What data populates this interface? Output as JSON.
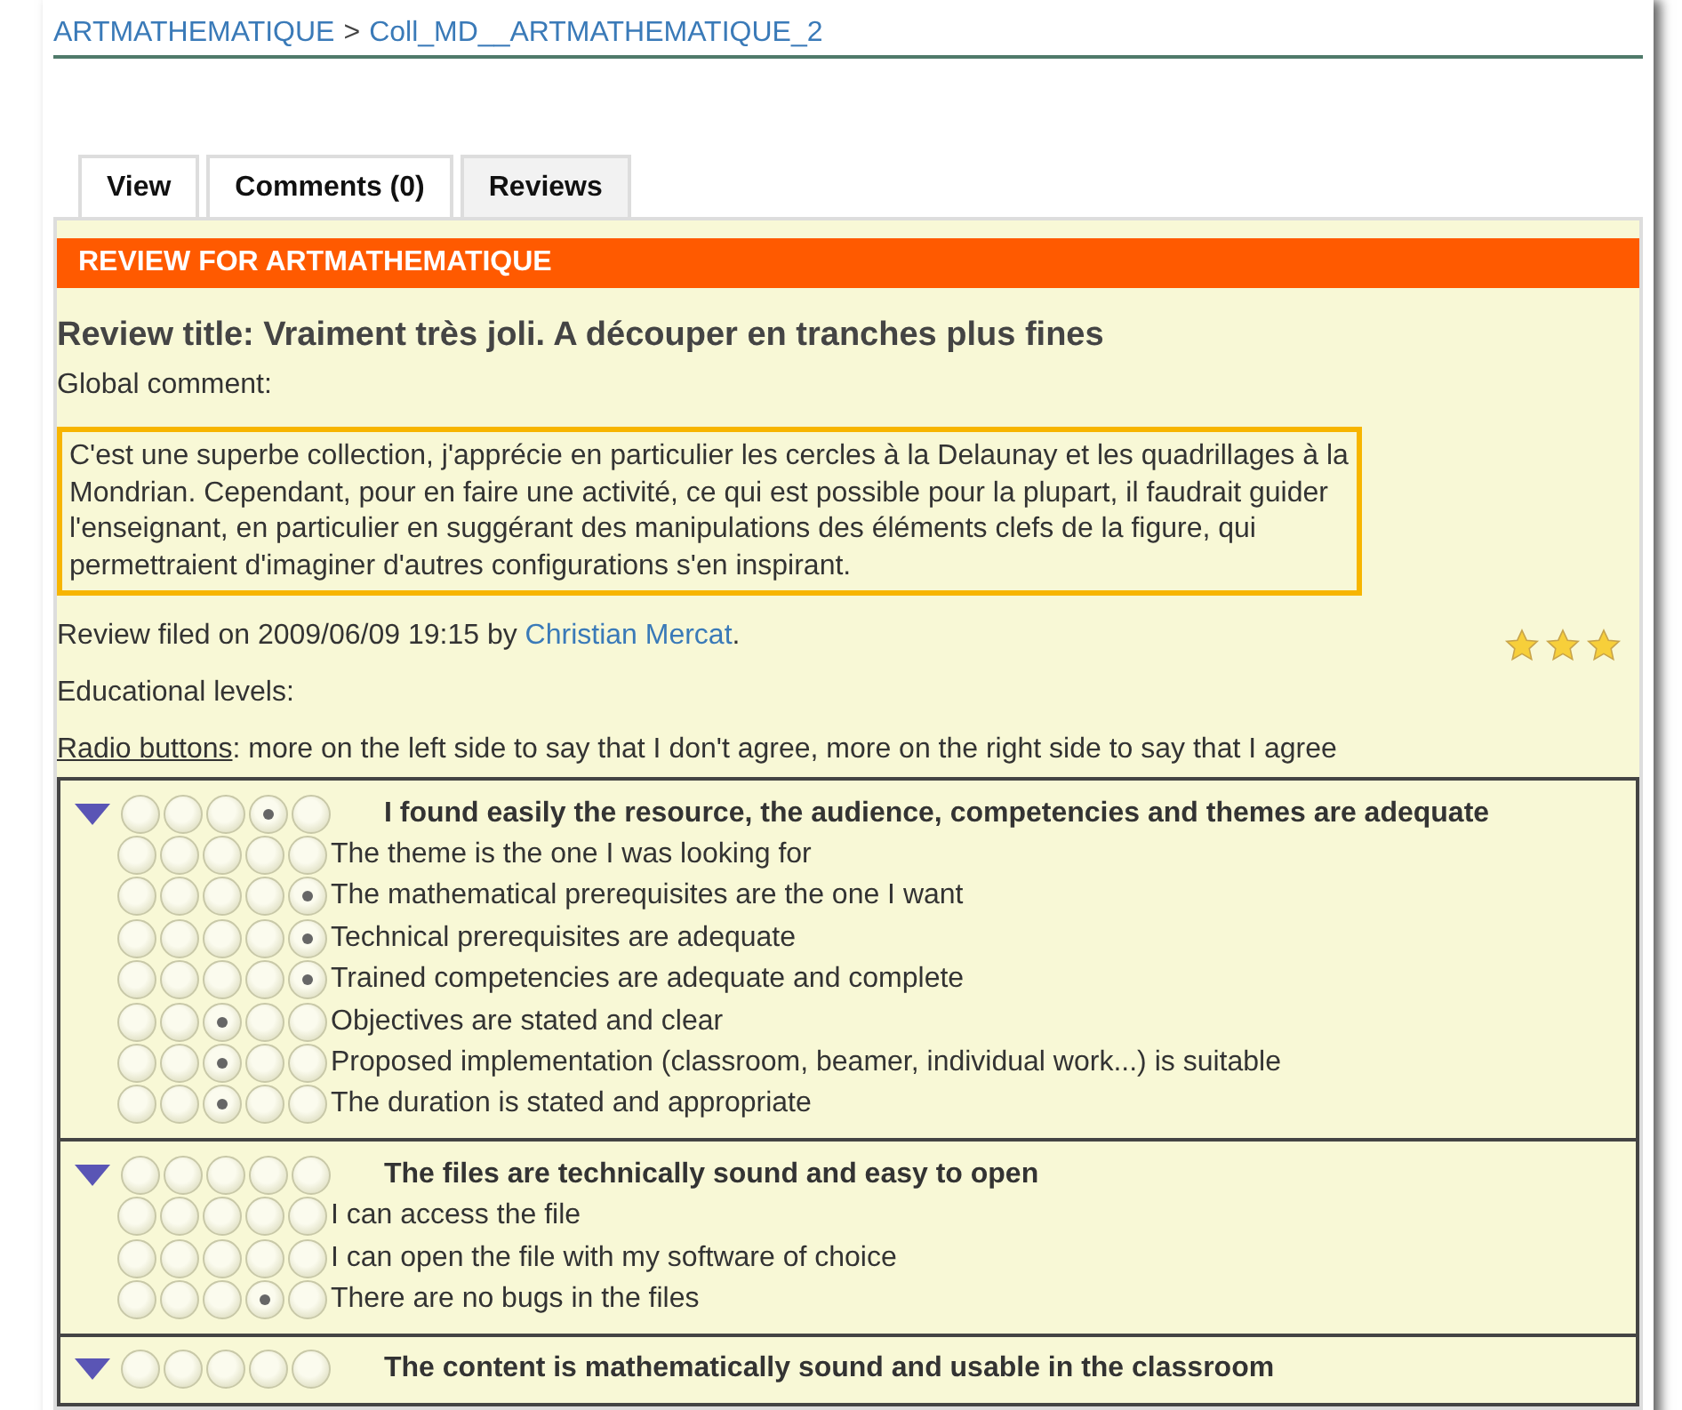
{
  "breadcrumb": [
    {
      "label": "ARTMATHEMATIQUE"
    },
    {
      "label": "Coll_MD__ARTMATHEMATIQUE_2"
    }
  ],
  "breadcrumb_separator": ">",
  "tabs": [
    {
      "label": "View",
      "selected": false
    },
    {
      "label": "Comments (0)",
      "selected": false
    },
    {
      "label": "Reviews",
      "selected": true
    }
  ],
  "review": {
    "header": "REVIEW FOR ARTMATHEMATIQUE",
    "title": "Review title: Vraiment très joli. A découper en tranches plus fines",
    "comment_label": "Global comment:",
    "comment": "C'est une superbe collection, j'apprécie en particulier les cercles à la Delaunay et les quadrillages à la Mondrian. Cependant, pour en faire une activité, ce qui est possible pour la plupart, il faudrait guider l'enseignant, en particulier en suggérant des manipulations des éléments clefs de la figure, qui permettraient d'imaginer d'autres configurations s'en inspirant.",
    "filed_prefix": "Review filed on 2009/06/09 19:15 by",
    "author": "Christian Mercat",
    "filed_suffix": ".",
    "stars": 3,
    "levels_label": "Educational levels:",
    "radio_link": "Radio buttons",
    "radio_hint": ": more on the left side to say that I don't agree, more on the right side to say that I agree"
  },
  "sections": [
    {
      "title": "I found easily the resource, the audience, competencies and themes are adequate",
      "expanded": true,
      "options": [
        {
          "selected": false
        },
        {
          "selected": false
        },
        {
          "selected": false
        },
        {
          "selected": true
        },
        {
          "selected": false
        }
      ],
      "items": [
        {
          "label": "The theme is the one I was looking for",
          "options": [
            {
              "selected": false
            },
            {
              "selected": false
            },
            {
              "selected": false
            },
            {
              "selected": false
            },
            {
              "selected": false
            }
          ]
        },
        {
          "label": "The mathematical prerequisites are the one I want",
          "options": [
            {
              "selected": false
            },
            {
              "selected": false
            },
            {
              "selected": false
            },
            {
              "selected": false
            },
            {
              "selected": true
            }
          ]
        },
        {
          "label": "Technical prerequisites are adequate",
          "options": [
            {
              "selected": false
            },
            {
              "selected": false
            },
            {
              "selected": false
            },
            {
              "selected": false
            },
            {
              "selected": true
            }
          ]
        },
        {
          "label": "Trained competencies are adequate and complete",
          "options": [
            {
              "selected": false
            },
            {
              "selected": false
            },
            {
              "selected": false
            },
            {
              "selected": false
            },
            {
              "selected": true
            }
          ]
        },
        {
          "label": "Objectives are stated and clear",
          "options": [
            {
              "selected": false
            },
            {
              "selected": false
            },
            {
              "selected": true
            },
            {
              "selected": false
            },
            {
              "selected": false
            }
          ]
        },
        {
          "label": "Proposed implementation (classroom, beamer, individual work...) is suitable",
          "options": [
            {
              "selected": false
            },
            {
              "selected": false
            },
            {
              "selected": true
            },
            {
              "selected": false
            },
            {
              "selected": false
            }
          ]
        },
        {
          "label": "The duration is stated and appropriate",
          "options": [
            {
              "selected": false
            },
            {
              "selected": false
            },
            {
              "selected": true
            },
            {
              "selected": false
            },
            {
              "selected": false
            }
          ]
        }
      ]
    },
    {
      "title": "The files are technically sound and easy to open",
      "expanded": true,
      "options": [
        {
          "selected": false
        },
        {
          "selected": false
        },
        {
          "selected": false
        },
        {
          "selected": false
        },
        {
          "selected": false
        }
      ],
      "items": [
        {
          "label": "I can access the file",
          "options": [
            {
              "selected": false
            },
            {
              "selected": false
            },
            {
              "selected": false
            },
            {
              "selected": false
            },
            {
              "selected": false
            }
          ]
        },
        {
          "label": "I can open the file with my software of choice",
          "options": [
            {
              "selected": false
            },
            {
              "selected": false
            },
            {
              "selected": false
            },
            {
              "selected": false
            },
            {
              "selected": false
            }
          ]
        },
        {
          "label": "There are no bugs in the files",
          "options": [
            {
              "selected": false
            },
            {
              "selected": false
            },
            {
              "selected": false
            },
            {
              "selected": true
            },
            {
              "selected": false
            }
          ]
        }
      ]
    },
    {
      "title": "The content is mathematically sound and usable in the classroom",
      "expanded": true,
      "options": [
        {
          "selected": false
        },
        {
          "selected": false
        },
        {
          "selected": false
        },
        {
          "selected": false
        },
        {
          "selected": false
        }
      ]
    }
  ]
}
